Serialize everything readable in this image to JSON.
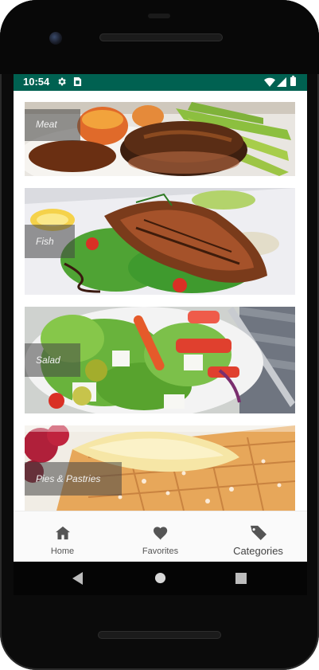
{
  "status_bar": {
    "time": "10:54",
    "icons": [
      "settings-gear-icon",
      "sim-card-icon",
      "wifi-icon",
      "signal-icon",
      "battery-icon"
    ],
    "color": "#006151"
  },
  "categories": [
    {
      "label": "Meat"
    },
    {
      "label": "Fish"
    },
    {
      "label": "Salad"
    },
    {
      "label": "Pies & Pastries"
    }
  ],
  "bottom_nav": {
    "items": [
      {
        "label": "Home",
        "icon": "home-icon"
      },
      {
        "label": "Favorites",
        "icon": "heart-icon"
      },
      {
        "label": "Categories",
        "icon": "tag-icon",
        "selected": true
      }
    ]
  },
  "system_nav": {
    "icons": [
      "back-icon",
      "home-circle-icon",
      "recents-square-icon"
    ]
  }
}
